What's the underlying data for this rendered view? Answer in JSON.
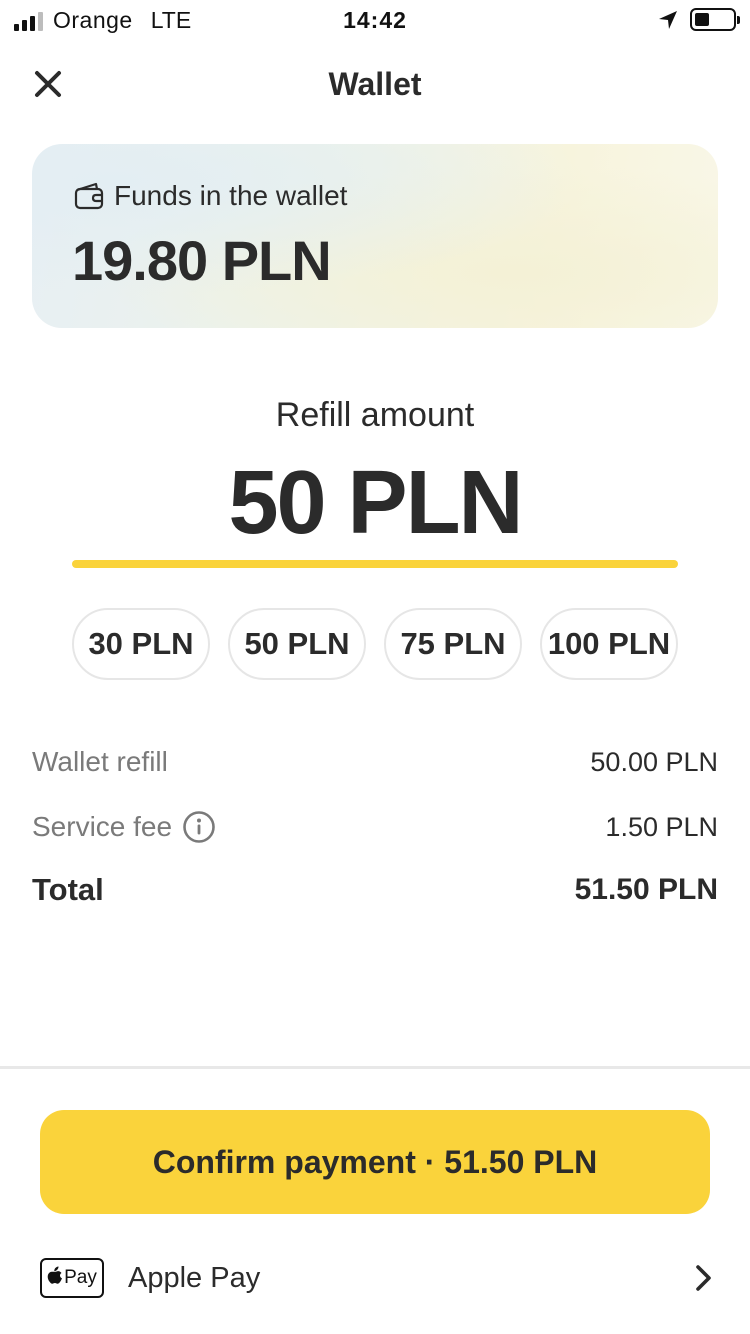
{
  "status_bar": {
    "carrier": "Orange",
    "network": "LTE",
    "time": "14:42",
    "battery_level": 0.38
  },
  "header": {
    "title": "Wallet",
    "close_icon": "close-icon"
  },
  "wallet": {
    "label": "Funds in the wallet",
    "amount": "19.80 PLN",
    "icon": "wallet-icon"
  },
  "refill": {
    "label": "Refill amount",
    "amount": "50 PLN",
    "accent_color": "#fad33b"
  },
  "chips": [
    {
      "label": "30 PLN"
    },
    {
      "label": "50 PLN"
    },
    {
      "label": "75 PLN"
    },
    {
      "label": "100 PLN"
    }
  ],
  "summary": {
    "wallet_refill_label": "Wallet refill",
    "wallet_refill_value": "50.00 PLN",
    "service_fee_label": "Service fee",
    "service_fee_value": "1.50 PLN",
    "total_label": "Total",
    "total_value": "51.50 PLN"
  },
  "footer": {
    "confirm_label": "Confirm payment · 51.50 PLN",
    "button_color": "#fad33b",
    "payment_method_badge": "Pay",
    "payment_method_label": "Apple Pay"
  }
}
